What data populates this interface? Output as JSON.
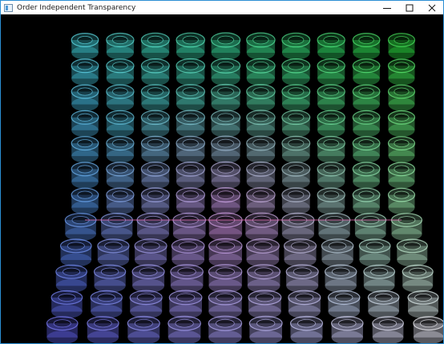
{
  "window": {
    "title": "Order Independent Transparency",
    "icon": "app-window-icon"
  },
  "titlebar_controls": [
    {
      "name": "minimize",
      "icon": "minimize-icon"
    },
    {
      "name": "maximize",
      "icon": "maximize-icon"
    },
    {
      "name": "close",
      "icon": "close-icon"
    }
  ],
  "scene": {
    "description_shown": "",
    "background_color": "#000000"
  }
}
